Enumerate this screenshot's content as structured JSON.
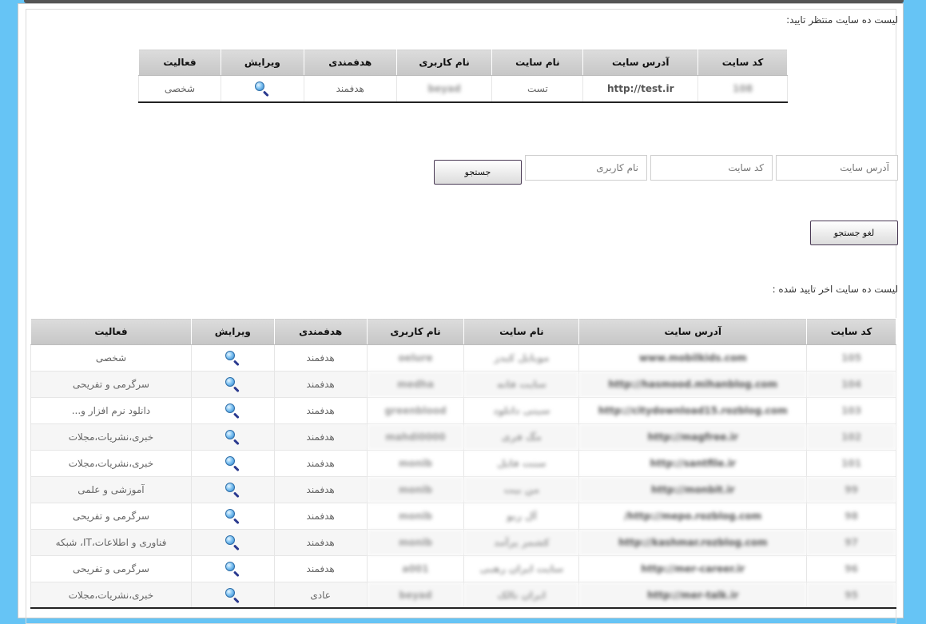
{
  "pending": {
    "heading": "لیست ده سایت منتظر تایید:",
    "columns": [
      "کد سایت",
      "آدرس سایت",
      "نام سایت",
      "نام کاربری",
      "هدفمندی",
      "ویرایش",
      "فعالیت"
    ],
    "rows": [
      {
        "code": "108",
        "url": "http://test.ir",
        "name": "تست",
        "user": "beyad",
        "target": "هدفمند",
        "activity": "شخصی"
      }
    ]
  },
  "search": {
    "url_placeholder": "آدرس سایت",
    "code_placeholder": "کد سایت",
    "user_placeholder": "نام کاربری",
    "search_label": "جستجو",
    "cancel_label": "لغو جستجو"
  },
  "approved": {
    "heading": "لیست ده سایت اخر تایید شده :",
    "columns": [
      "کد سایت",
      "آدرس سایت",
      "نام سایت",
      "نام کاربری",
      "هدفمندی",
      "ویرایش",
      "فعالیت"
    ],
    "rows": [
      {
        "code": "105",
        "url": "www.mobilkids.com",
        "name": "موبایل کیدز",
        "user": "oelure",
        "target": "هدفمند",
        "activity": "شخصی"
      },
      {
        "code": "104",
        "url": "http://hasmood.mihanblog.com",
        "name": "سایت فانه",
        "user": "medha",
        "target": "هدفمند",
        "activity": "سرگرمی و تفریحی"
      },
      {
        "code": "103",
        "url": "http://citydownload15.rozblog.com",
        "name": "سیتی دانلود",
        "user": "greenblood",
        "target": "هدفمند",
        "activity": "دانلود نرم افزار و..."
      },
      {
        "code": "102",
        "url": "http://magfree.ir",
        "name": "مگ فری",
        "user": "mahdi0000",
        "target": "هدفمند",
        "activity": "خبری،نشریات،مجلات"
      },
      {
        "code": "101",
        "url": "http://santfile.ir",
        "name": "سنت فایل",
        "user": "monib",
        "target": "هدفمند",
        "activity": "خبری،نشریات،مجلات"
      },
      {
        "code": "99",
        "url": "http://monbit.ir",
        "name": "من بیت",
        "user": "monib",
        "target": "هدفمند",
        "activity": "آموزشی و علمی"
      },
      {
        "code": "98",
        "url": "http://mepo.rozblog.com/",
        "name": "آل ربو",
        "user": "monib",
        "target": "هدفمند",
        "activity": "سرگرمی و تفریحی"
      },
      {
        "code": "97",
        "url": "http://kashmar.rozblog.com",
        "name": "کشمر پرآمد",
        "user": "monib",
        "target": "هدفمند",
        "activity": "فناوری و اطلاعات،IT، شبکه"
      },
      {
        "code": "96",
        "url": "http://mer-career.ir",
        "name": "سایت ایران رهبی",
        "user": "a001",
        "target": "هدفمند",
        "activity": "سرگرمی و تفریحی"
      },
      {
        "code": "95",
        "url": "http://mer-talk.ir",
        "name": "ایران تالک",
        "user": "beyad",
        "target": "عادی",
        "activity": "خبری،نشریات،مجلات"
      }
    ]
  },
  "icons": {
    "edit": "magnifier-icon"
  }
}
